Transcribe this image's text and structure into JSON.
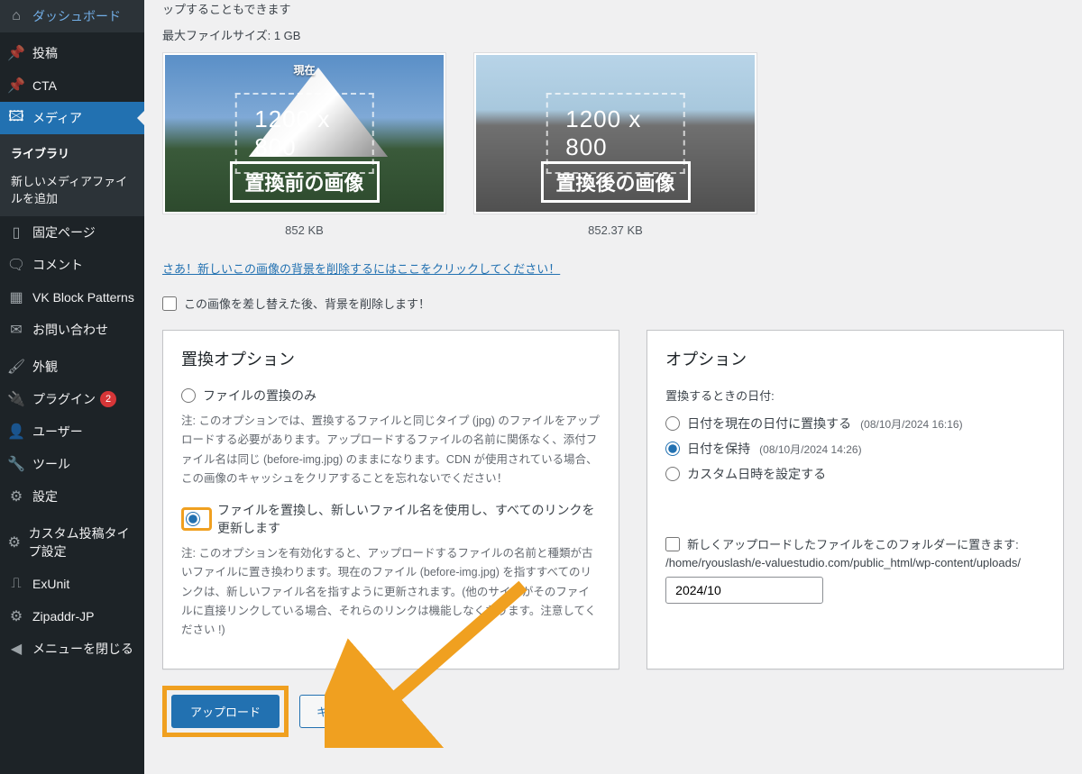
{
  "sidebar": {
    "items": [
      {
        "label": "ダッシュボード",
        "icon": "🏠"
      },
      {
        "label": "投稿",
        "icon": "✎"
      },
      {
        "label": "CTA",
        "icon": "📌"
      },
      {
        "label": "メディア",
        "icon": "🖼",
        "active": true
      },
      {
        "label": "固定ページ",
        "icon": "📄"
      },
      {
        "label": "コメント",
        "icon": "💬"
      },
      {
        "label": "VK Block Patterns",
        "icon": "▦"
      },
      {
        "label": "お問い合わせ",
        "icon": "✉"
      },
      {
        "label": "外観",
        "icon": "🖌"
      },
      {
        "label": "プラグイン",
        "icon": "🔌",
        "badge": "2"
      },
      {
        "label": "ユーザー",
        "icon": "👤"
      },
      {
        "label": "ツール",
        "icon": "🔧"
      },
      {
        "label": "設定",
        "icon": "⚙"
      },
      {
        "label": "カスタム投稿タイプ設定",
        "icon": "⚙"
      },
      {
        "label": "ExUnit",
        "icon": "⎍"
      },
      {
        "label": "Zipaddr-JP",
        "icon": "⚙"
      },
      {
        "label": "メニューを閉じる",
        "icon": "◀"
      }
    ],
    "submenu": [
      "ライブラリ",
      "新しいメディアファイルを追加"
    ]
  },
  "top": {
    "intro_line": "ップすることもできます",
    "max_size": "最大ファイルサイズ: 1 GB"
  },
  "thumbs": {
    "left": {
      "label_top": "現在",
      "dim": "1200 x 800",
      "caption": "置換前の画像",
      "size": "852 KB"
    },
    "right": {
      "dim": "1200 x 800",
      "caption": "置換後の画像",
      "size": "852.37 KB"
    }
  },
  "bg_link": "さあ！新しいこの画像の背景を削除するにはここをクリックしてください！",
  "bg_checkbox": "この画像を差し替えた後、背景を削除します！",
  "left_panel": {
    "title": "置換オプション",
    "opt1_label": "ファイルの置換のみ",
    "opt1_note": "注: このオプションでは、置換するファイルと同じタイプ (jpg) のファイルをアップロードする必要があります。アップロードするファイルの名前に関係なく、添付ファイル名は同じ (before-img.jpg) のままになります。CDN が使用されている場合、この画像のキャッシュをクリアすることを忘れないでください！",
    "opt2_label": "ファイルを置換し、新しいファイル名を使用し、すべてのリンクを更新します",
    "opt2_note": "注: このオプションを有効化すると、アップロードするファイルの名前と種類が古いファイルに置き換わります。現在のファイル (before-img.jpg) を指すすべてのリンクは、新しいファイル名を指すように更新されます。(他のサイトがそのファイルに直接リンクしている場合、それらのリンクは機能しなくなります。注意してください !)"
  },
  "right_panel": {
    "title": "オプション",
    "subhead": "置換するときの日付:",
    "opt1": "日付を現在の日付に置換する",
    "opt1_date": "(08/10月/2024 16:16)",
    "opt2": "日付を保持",
    "opt2_date": "(08/10月/2024 14:26)",
    "opt3": "カスタム日時を設定する",
    "folder_check": "新しくアップロードしたファイルをこのフォルダーに置きます:",
    "folder_path": "/home/ryouslash/e-valuestudio.com/public_html/wp-content/uploads/",
    "folder_input": "2024/10"
  },
  "actions": {
    "upload": "アップロード",
    "cancel": "キャンセル"
  }
}
